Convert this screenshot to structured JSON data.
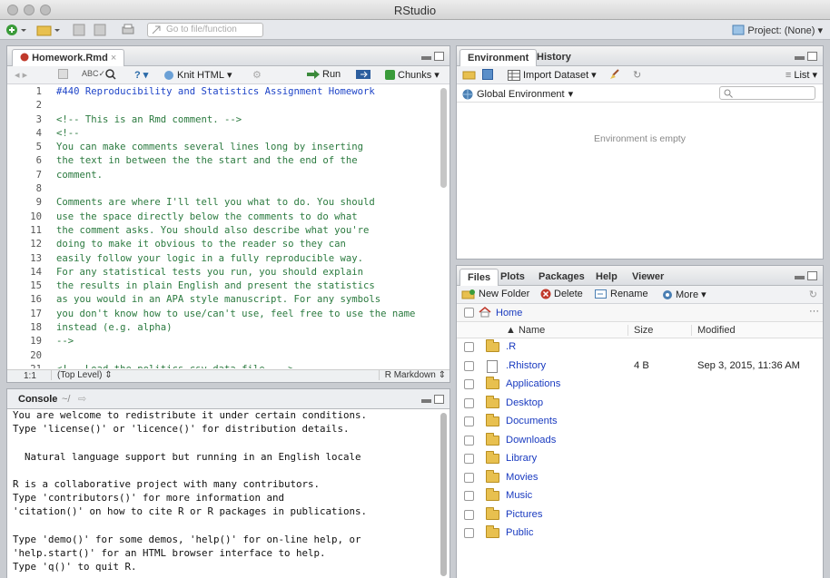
{
  "window": {
    "title": "RStudio"
  },
  "toolbar": {
    "goto_placeholder": "Go to file/function",
    "project": "Project: (None)"
  },
  "editor": {
    "tab": "Homework.Rmd",
    "knit": "Knit HTML",
    "run": "Run",
    "chunks": "Chunks",
    "lines": [
      {
        "n": "1",
        "text": "#440 Reproducibility and Statistics Assignment Homework"
      },
      {
        "n": "2",
        "text": ""
      },
      {
        "n": "3",
        "text": "<!-- This is an Rmd comment. -->"
      },
      {
        "n": "4",
        "text": "<!--"
      },
      {
        "n": "5",
        "text": "You can make comments several lines long by inserting"
      },
      {
        "n": "6",
        "text": "the text in between the the start and the end of the"
      },
      {
        "n": "7",
        "text": "comment."
      },
      {
        "n": "8",
        "text": ""
      },
      {
        "n": "9",
        "text": "Comments are where I'll tell you what to do. You should"
      },
      {
        "n": "10",
        "text": "use the space directly below the comments to do what"
      },
      {
        "n": "11",
        "text": "the comment asks. You should also describe what you're"
      },
      {
        "n": "12",
        "text": "doing to make it obvious to the reader so they can"
      },
      {
        "n": "13",
        "text": "easily follow your logic in a fully reproducible way."
      },
      {
        "n": "14",
        "text": "For any statistical tests you run, you should explain"
      },
      {
        "n": "15",
        "text": "the results in plain English and present the statistics"
      },
      {
        "n": "16",
        "text": "as you would in an APA style manuscript. For any symbols"
      },
      {
        "n": "17",
        "text": "you don't know how to use/can't use, feel free to use the name"
      },
      {
        "n": "18",
        "text": "instead (e.g. alpha)"
      },
      {
        "n": "19",
        "text": "-->"
      },
      {
        "n": "20",
        "text": ""
      },
      {
        "n": "21",
        "text": "<!-- Load the politics.csv data file. -->"
      }
    ],
    "status_pos": "1:1",
    "status_scope": "(Top Level)",
    "status_mode": "R Markdown"
  },
  "console": {
    "title": "Console",
    "path": "~/",
    "lines": [
      "You are welcome to redistribute it under certain conditions.",
      "Type 'license()' or 'licence()' for distribution details.",
      "",
      "  Natural language support but running in an English locale",
      "",
      "R is a collaborative project with many contributors.",
      "Type 'contributors()' for more information and",
      "'citation()' on how to cite R or R packages in publications.",
      "",
      "Type 'demo()' for some demos, 'help()' for on-line help, or",
      "'help.start()' for an HTML browser interface to help.",
      "Type 'q()' to quit R."
    ]
  },
  "environment": {
    "tabs": [
      "Environment",
      "History"
    ],
    "import": "Import Dataset",
    "list": "List",
    "global": "Global Environment",
    "empty": "Environment is empty"
  },
  "files": {
    "tabs": [
      "Files",
      "Plots",
      "Packages",
      "Help",
      "Viewer"
    ],
    "new_folder": "New Folder",
    "delete": "Delete",
    "rename": "Rename",
    "more": "More",
    "breadcrumb": "Home",
    "col_name": "Name",
    "col_size": "Size",
    "col_modified": "Modified",
    "rows": [
      {
        "name": ".R",
        "size": "",
        "modified": ""
      },
      {
        "name": ".Rhistory",
        "size": "4 B",
        "modified": "Sep 3, 2015, 11:36 AM"
      },
      {
        "name": "Applications",
        "size": "",
        "modified": ""
      },
      {
        "name": "Desktop",
        "size": "",
        "modified": ""
      },
      {
        "name": "Documents",
        "size": "",
        "modified": ""
      },
      {
        "name": "Downloads",
        "size": "",
        "modified": ""
      },
      {
        "name": "Library",
        "size": "",
        "modified": ""
      },
      {
        "name": "Movies",
        "size": "",
        "modified": ""
      },
      {
        "name": "Music",
        "size": "",
        "modified": ""
      },
      {
        "name": "Pictures",
        "size": "",
        "modified": ""
      },
      {
        "name": "Public",
        "size": "",
        "modified": ""
      }
    ]
  }
}
